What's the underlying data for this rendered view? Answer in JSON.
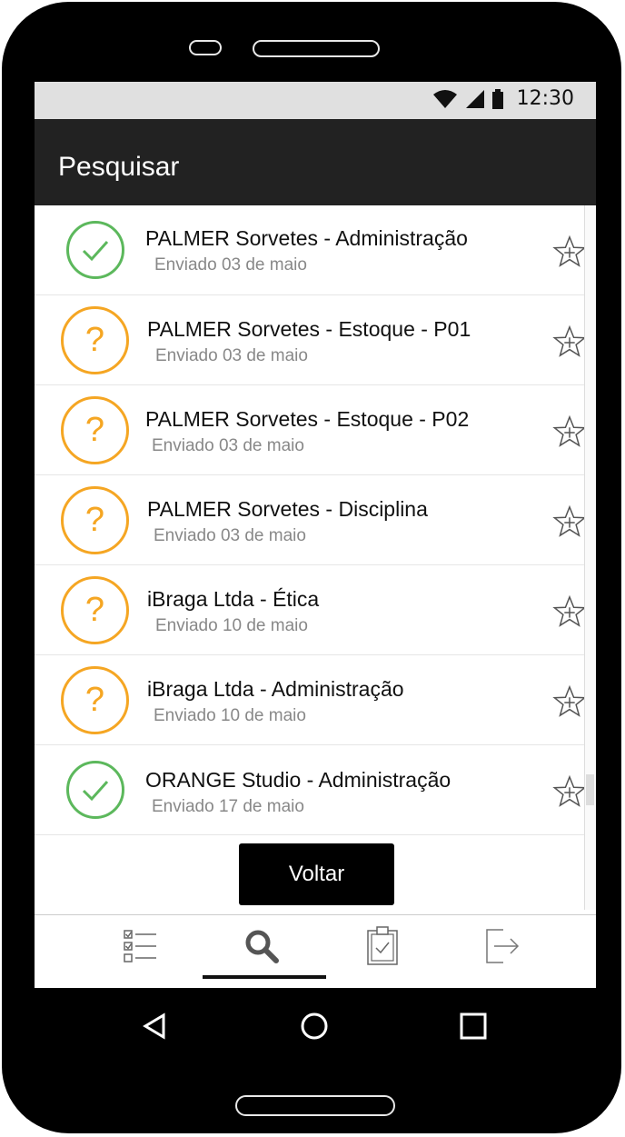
{
  "status_bar": {
    "time": "12:30",
    "icons": [
      "wifi-icon",
      "signal-icon",
      "battery-icon"
    ]
  },
  "app_bar": {
    "title": "Pesquisar"
  },
  "list": {
    "items": [
      {
        "title": "PALMER Sorvetes - Administração",
        "subtitle": "Enviado 03 de maio",
        "status": "complete",
        "status_icon": "check-icon",
        "status_color": "#5cb85c"
      },
      {
        "title": "PALMER Sorvetes - Estoque - P01",
        "subtitle": "Enviado 03 de maio",
        "status": "pending",
        "status_icon": "?",
        "status_color": "#f5a623"
      },
      {
        "title": "PALMER Sorvetes - Estoque - P02",
        "subtitle": "Enviado 03 de maio",
        "status": "pending",
        "status_icon": "?",
        "status_color": "#f5a623"
      },
      {
        "title": "PALMER Sorvetes - Disciplina",
        "subtitle": "Enviado 03 de maio",
        "status": "pending",
        "status_icon": "?",
        "status_color": "#f5a623"
      },
      {
        "title": "iBraga Ltda - Ética",
        "subtitle": "Enviado 10 de maio",
        "status": "pending",
        "status_icon": "?",
        "status_color": "#f5a623"
      },
      {
        "title": "iBraga Ltda - Administração",
        "subtitle": "Enviado 10 de maio",
        "status": "pending",
        "status_icon": "?",
        "status_color": "#f5a623"
      },
      {
        "title": "ORANGE Studio - Administração",
        "subtitle": "Enviado 17 de maio",
        "status": "complete",
        "status_icon": "check-icon",
        "status_color": "#5cb85c"
      }
    ]
  },
  "actions": {
    "back_label": "Voltar"
  },
  "bottom_nav": {
    "items": [
      {
        "icon": "checklist-icon",
        "active": false
      },
      {
        "icon": "search-icon",
        "active": true
      },
      {
        "icon": "clipboard-icon",
        "active": false
      },
      {
        "icon": "logout-icon",
        "active": false
      }
    ]
  },
  "system_nav": {
    "items": [
      "back-triangle-icon",
      "home-circle-icon",
      "recents-square-icon"
    ]
  }
}
